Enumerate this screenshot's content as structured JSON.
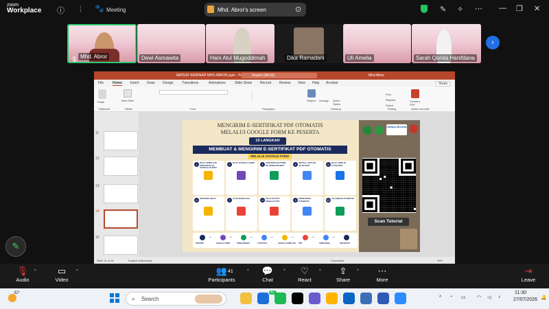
{
  "zoom": {
    "logo_line1": "zoom",
    "logo_line2": "Workplace",
    "meeting_label": "Meeting",
    "share_title": "Mhd. Abror's screen"
  },
  "participants": [
    {
      "name": "Mhd. Abror",
      "active": true
    },
    {
      "name": "Dewi Asmawita"
    },
    {
      "name": "Hani Atul Mugoddimah"
    },
    {
      "name": "Dika Ramadani"
    },
    {
      "name": "Uli Amelia"
    },
    {
      "name": "Sarah Qonita Hanifdana"
    }
  ],
  "ppt": {
    "window_title": "MATERI WEBINAR MHD ABROR.pptx - PowerPoint",
    "user": "Mhd Abror",
    "search_placeholder": "Search (Alt+Q)",
    "menus": [
      "File",
      "Home",
      "Insert",
      "Draw",
      "Design",
      "Transitions",
      "Animations",
      "Slide Show",
      "Record",
      "Review",
      "View",
      "Help",
      "Acrobat"
    ],
    "share_btn": "Share",
    "ribbon": [
      "Clipboard",
      "Slides",
      "Font",
      "Paragraph",
      "Drawing",
      "Editing",
      "Adobe Acrobat"
    ],
    "ribbon_buttons": {
      "paste": "Paste",
      "new_slide": "New Slide",
      "shapes": "Shapes",
      "arrange": "Arrange",
      "quick_styles": "Quick Styles",
      "find": "Find",
      "replace": "Replace",
      "select": "Select",
      "create_pdf": "Create a PDF"
    },
    "slide_numbers": [
      "11",
      "12",
      "13",
      "14",
      "15"
    ],
    "status_left": "Slide 14 of 16",
    "status_lang": "English (Indonesia)",
    "status_comments": "Comments",
    "zoom_level": "39%"
  },
  "slide": {
    "title_line1": "MENGIRIM E-SERTIFIKAT PDF OTOMATIS",
    "title_line2": "MELALUI GOOGLE FORM KE PESERTA",
    "badge": "10 LANGKAH",
    "heading": "MEMBUAT & MENGIRIM E-SERTIFIKAT PDF OTOMATIS",
    "subheading": "MELALUI GOOGLE FORM",
    "steps": [
      {
        "n": "1",
        "t": "BUAT TEMPLATE SERTIFIKAT DI GOOGLE SLIDES",
        "c": "#f4b400"
      },
      {
        "n": "2",
        "t": "BUAT GOOGLE FORM",
        "c": "#7248b9"
      },
      {
        "n": "3",
        "t": "HUBUNGKAN FORM KE SPREADSHEET",
        "c": "#0f9d58"
      },
      {
        "n": "4",
        "t": "INSTALL ADD-ON AUTOCRAT",
        "c": "#4285f4"
      },
      {
        "n": "5",
        "t": "BUAT JOBS DI AUTOCRAT",
        "c": "#1a73e8"
      },
      {
        "n": "6",
        "t": "MAPPING FIELD",
        "c": "#f4b400"
      },
      {
        "n": "7",
        "t": "ATUR NAMA FILE",
        "c": "#ea4335"
      },
      {
        "n": "8",
        "t": "PILIH OUTPUT SEBAGAI PDF",
        "c": "#ea4335"
      },
      {
        "n": "9",
        "t": "KIRIM EMAIL OTOMATIS",
        "c": "#4285f4"
      },
      {
        "n": "10",
        "t": "JALANKAN OTOMATIS",
        "c": "#0f9d58"
      }
    ],
    "flow": [
      "PESERTA",
      "GOOGLE FORM",
      "SPREADSHEET",
      "AUTOCRAT",
      "GOOGLE TEMPLATE",
      "PDF",
      "KIRIM EMAIL",
      "SERTIFIKAT"
    ],
    "logo_text": "Kampus Merdeka",
    "scan_label": "Scan Tutorial"
  },
  "toolbar": {
    "audio": "Audio",
    "video": "Video",
    "participants": "Participants",
    "participants_count": "41",
    "chat": "Chat",
    "react": "React",
    "share": "Share",
    "more": "More",
    "leave": "Leave"
  },
  "taskbar": {
    "temperature": "32°",
    "search": "Search",
    "chat_badge": "47",
    "time": "11:30",
    "date": "27/07/2026"
  },
  "colors": {
    "ppt_accent": "#b7472a",
    "slide_navy": "#1b2a5c",
    "slide_yellow": "#ffd24a",
    "active_border": "#2ecc71"
  }
}
